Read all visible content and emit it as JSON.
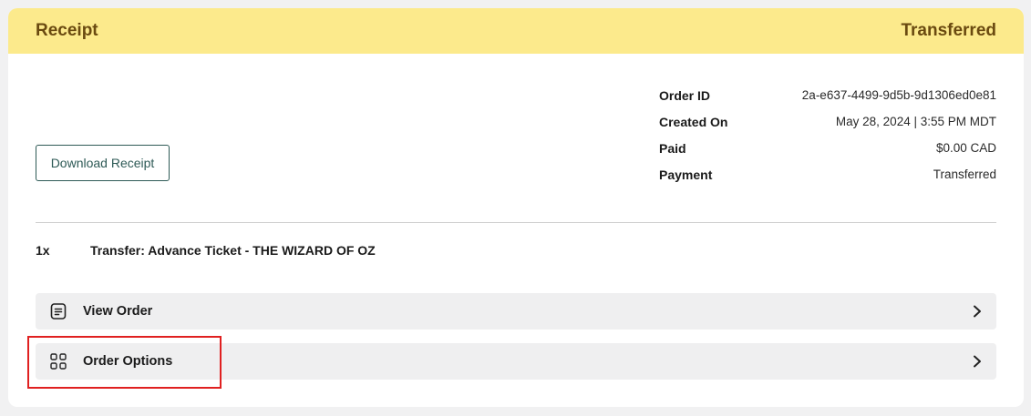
{
  "header": {
    "title": "Receipt",
    "status": "Transferred",
    "background_color": "#fcea8c",
    "text_color": "#6a4a10"
  },
  "download_button": {
    "label": "Download Receipt"
  },
  "order_details": [
    {
      "label": "Order ID",
      "value": "2a-e637-4499-9d5b-9d1306ed0e81"
    },
    {
      "label": "Created On",
      "value": "May 28, 2024 | 3:55 PM MDT"
    },
    {
      "label": "Paid",
      "value": "$0.00 CAD"
    },
    {
      "label": "Payment",
      "value": "Transferred"
    }
  ],
  "line_items": [
    {
      "qty": "1x",
      "description": "Transfer: Advance Ticket - THE WIZARD OF OZ"
    }
  ],
  "actions": [
    {
      "label": "View Order",
      "icon": "document-list-icon"
    },
    {
      "label": "Order Options",
      "icon": "grid-icon"
    }
  ],
  "highlight_color": "#e02020"
}
